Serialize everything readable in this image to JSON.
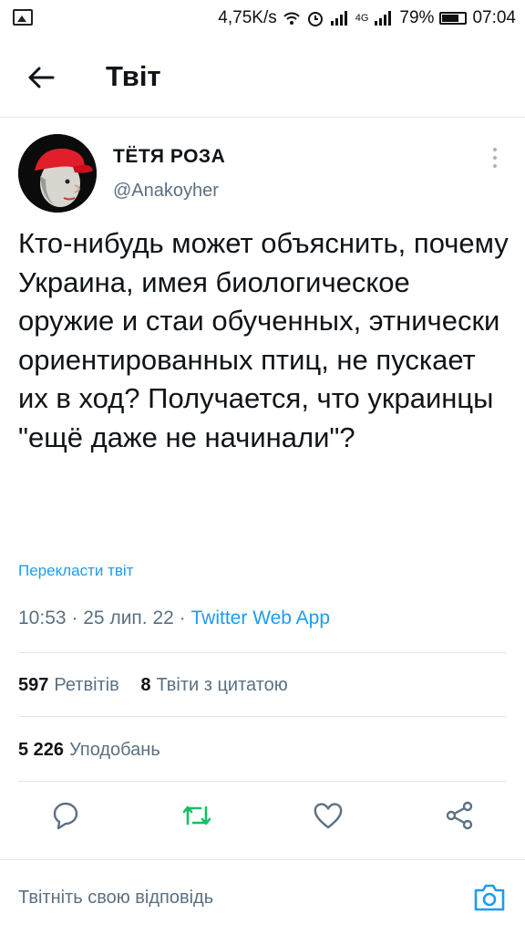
{
  "status_bar": {
    "speed": "4,75K/s",
    "network": "4G",
    "battery": "79%",
    "battery_level": 0.79,
    "time": "07:04"
  },
  "header": {
    "title": "Твіт"
  },
  "tweet": {
    "author_name": "ТЁТЯ РОЗА",
    "author_handle": "@Anakoyher",
    "text": "Кто-нибудь может объяснить, почему Украина, имея биологическое оружие и стаи обученных, этнически ориентированных птиц, не пускает их в ход? Получается, что украинцы \"ещё даже не начинали\"?",
    "translate_label": "Перекласти твіт",
    "time": "10:53",
    "date": "25 лип. 22",
    "separator": "·",
    "source": "Twitter Web App",
    "retweets_count": "597",
    "retweets_label": "Ретвітів",
    "quotes_count": "8",
    "quotes_label": "Твіти з цитатою",
    "likes_count": "5 226",
    "likes_label": "Уподобань"
  },
  "reply": {
    "placeholder": "Твітніть свою відповідь"
  },
  "colors": {
    "accent": "#1d9bf0",
    "retweet": "#17bf63",
    "muted": "#5b7083"
  }
}
